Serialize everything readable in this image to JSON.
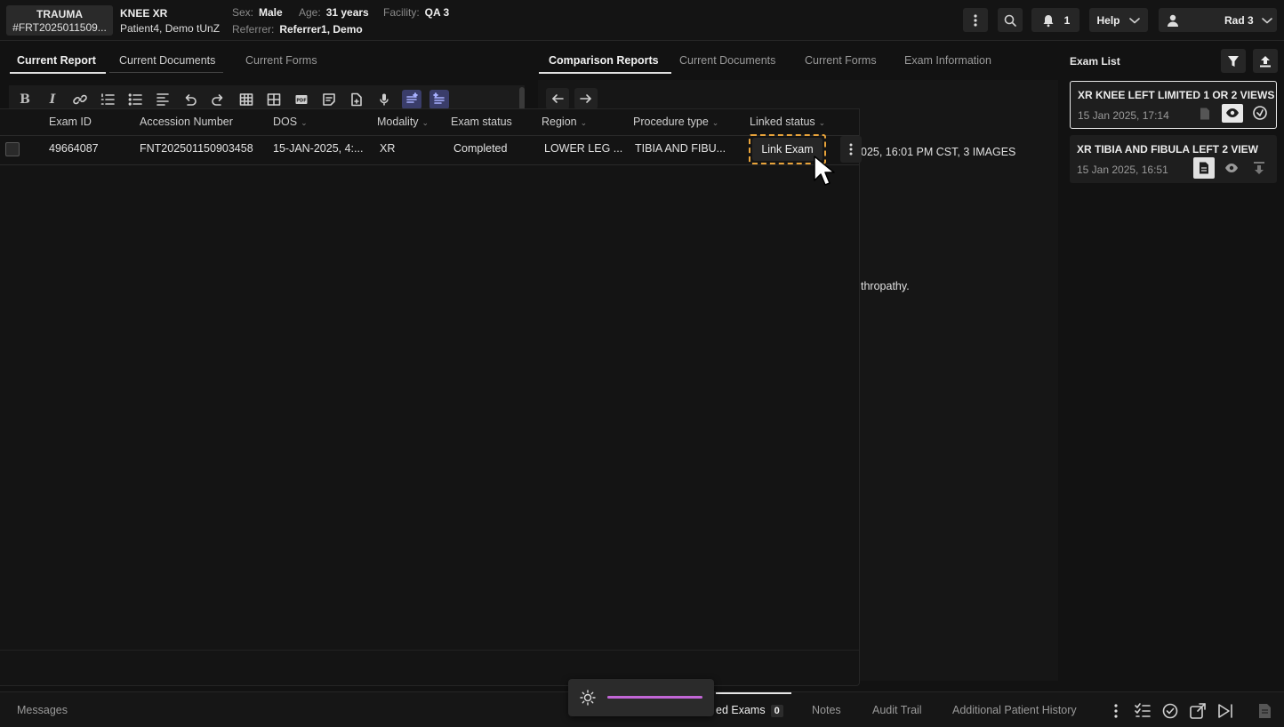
{
  "header": {
    "case_label": "TRAUMA",
    "case_id": "#FRT2025011509...",
    "exam_title": "KNEE XR",
    "patient_name": "Patient4, Demo tUnZ",
    "sex_label": "Sex:",
    "sex_value": "Male",
    "age_label": "Age:",
    "age_value": "31 years",
    "facility_label": "Facility:",
    "facility_value": "QA 3",
    "referrer_label": "Referrer:",
    "referrer_value": "Referrer1, Demo",
    "notification_count": "1",
    "help_label": "Help",
    "user_label": "Rad 3"
  },
  "left_tabs": [
    "Current Report",
    "Current Documents",
    "Current Forms"
  ],
  "right_tabs": [
    "Comparison Reports",
    "Current Documents",
    "Current Forms",
    "Exam Information"
  ],
  "toolbar": {
    "icons": [
      "bold-icon",
      "italic-icon",
      "link-icon",
      "ordered-list-icon",
      "bullet-list-icon",
      "align-icon",
      "undo-icon",
      "redo-icon",
      "table-icon",
      "grid-icon",
      "pdf-icon",
      "template-icon",
      "file-add-icon",
      "microphone-icon",
      "ai-assist-icon",
      "ai-report-icon"
    ]
  },
  "comparison": {
    "header_fragment": "025, 16:01 PM CST, 3 IMAGES",
    "body_fragment": "thropathy."
  },
  "table": {
    "columns": [
      "Exam ID",
      "Accession Number",
      "DOS",
      "Modality",
      "Exam status",
      "Region",
      "Procedure type",
      "Linked status"
    ],
    "rows": [
      {
        "exam_id": "49664087",
        "accession": "FNT202501150903458",
        "dos": "15-JAN-2025, 4:...",
        "modality": "XR",
        "status": "Completed",
        "region": "LOWER LEG ...",
        "procedure": "TIBIA AND FIBU...",
        "link_label": "Link Exam"
      }
    ]
  },
  "exam_list": {
    "title": "Exam List",
    "items": [
      {
        "title": "XR KNEE LEFT LIMITED 1 OR 2 VIEWS",
        "date": "15 Jan 2025, 17:14"
      },
      {
        "title": "XR TIBIA AND FIBULA LEFT 2 VIEW",
        "date": "15 Jan 2025, 16:51"
      }
    ]
  },
  "bottom": {
    "messages": "Messages",
    "linked_exams_fragment": "ed Exams",
    "linked_count": "0",
    "notes": "Notes",
    "audit": "Audit Trail",
    "history": "Additional Patient History"
  },
  "brightness": {
    "level": 1.0,
    "accent": "#c266d6"
  },
  "colors": {
    "highlight_dashed": "#e8a33a",
    "toolbar_highlight": "#3a3d6a"
  }
}
